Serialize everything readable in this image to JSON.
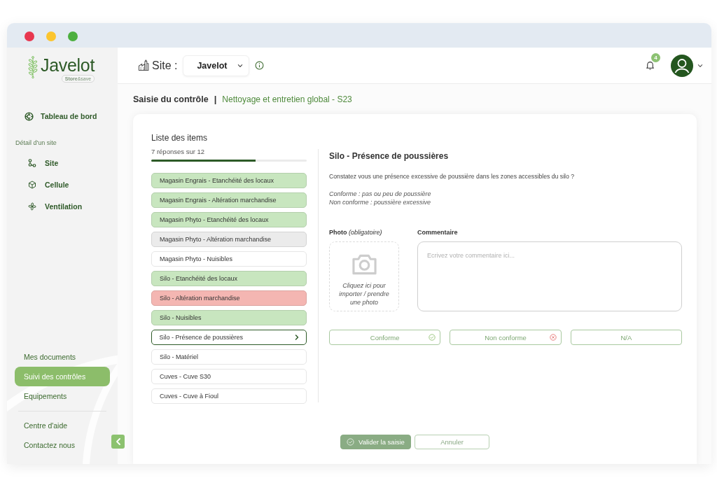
{
  "sidebar": {
    "brand": {
      "name": "Javelot",
      "tagline": "**Store**&save"
    },
    "dashboard": {
      "label": "Tableau de bord",
      "selected": false
    },
    "section_title": "Détail d'un site",
    "site_items": [
      {
        "label": "Site",
        "selected": false
      },
      {
        "label": "Cellule",
        "selected": false
      },
      {
        "label": "Ventilation",
        "selected": false
      }
    ],
    "nav_items": [
      {
        "label": "Mes documents",
        "selected": false
      },
      {
        "label": "Suivi des contrôles",
        "selected": true
      },
      {
        "label": "Equipements",
        "selected": false
      }
    ],
    "help_items": [
      {
        "label": "Centre d'aide"
      },
      {
        "label": "Contactez nous"
      }
    ]
  },
  "header": {
    "site_label": "Site :",
    "site_select": {
      "value": "Javelot"
    },
    "notifications": {
      "count": "4"
    }
  },
  "breadcrumb": {
    "title": "Saisie du contrôle",
    "separator": "|",
    "subtitle": "Nettoyage et entretien global - S23"
  },
  "items_panel": {
    "title": "Liste des items",
    "progress_text": "7 réponses sur 12",
    "level": 0.67,
    "items": [
      {
        "label": "Magasin Engrais - Etanchéité des locaux",
        "color": "#c8e6bf",
        "selected": false
      },
      {
        "label": "Magasin Engrais - Altération marchandise",
        "color": "#c8e6bf",
        "selected": false
      },
      {
        "label": "Magasin Phyto - Etanchéité des locaux",
        "color": "#c8e6bf",
        "selected": false
      },
      {
        "label": "Magasin Phyto - Altération marchandise",
        "color": "#ebebeb",
        "selected": false
      },
      {
        "label": "Magasin Phyto - Nuisibles",
        "color": "#ffffff",
        "selected": false
      },
      {
        "label": "Silo - Etanchéité des locaux",
        "color": "#c8e6bf",
        "selected": false
      },
      {
        "label": "Silo - Altération marchandise",
        "color": "#f4b6b2",
        "selected": false
      },
      {
        "label": "Silo - Nuisibles",
        "color": "#c8e6bf",
        "selected": false
      },
      {
        "label": "Silo - Présence de poussières",
        "color": "#ffffff",
        "selected": true
      },
      {
        "label": "Silo - Matériel",
        "color": "#ffffff",
        "selected": false
      },
      {
        "label": "Cuves - Cuve S30",
        "color": "#ffffff",
        "selected": false
      },
      {
        "label": "Cuves - Cuve à Fioul",
        "color": "#ffffff",
        "selected": false
      }
    ]
  },
  "detail": {
    "title": "Silo - Présence de poussières",
    "question": "Constatez vous une présence excessive de poussière dans les zones accessibles du silo ?",
    "hints": [
      "Conforme : pas ou peu de poussière",
      "Non conforme : poussière excessive"
    ],
    "photo": {
      "label": "**Photo** *(obligatoire)*",
      "hint": "Cliquez ici pour importer / prendre une photo"
    },
    "comment": {
      "label": "Commentaire",
      "placeholder": "Ecrivez votre commentaire ici..."
    },
    "answers": [
      {
        "label": "Conforme",
        "kind": "conforme",
        "selected": false
      },
      {
        "label": "Non conforme",
        "kind": "non_conforme",
        "selected": false
      },
      {
        "label": "N/A",
        "kind": "na",
        "selected": false
      }
    ]
  },
  "actions": [
    {
      "label": "Valider la saisie",
      "kind": "primary"
    },
    {
      "label": "Annuler",
      "kind": "secondary"
    }
  ]
}
